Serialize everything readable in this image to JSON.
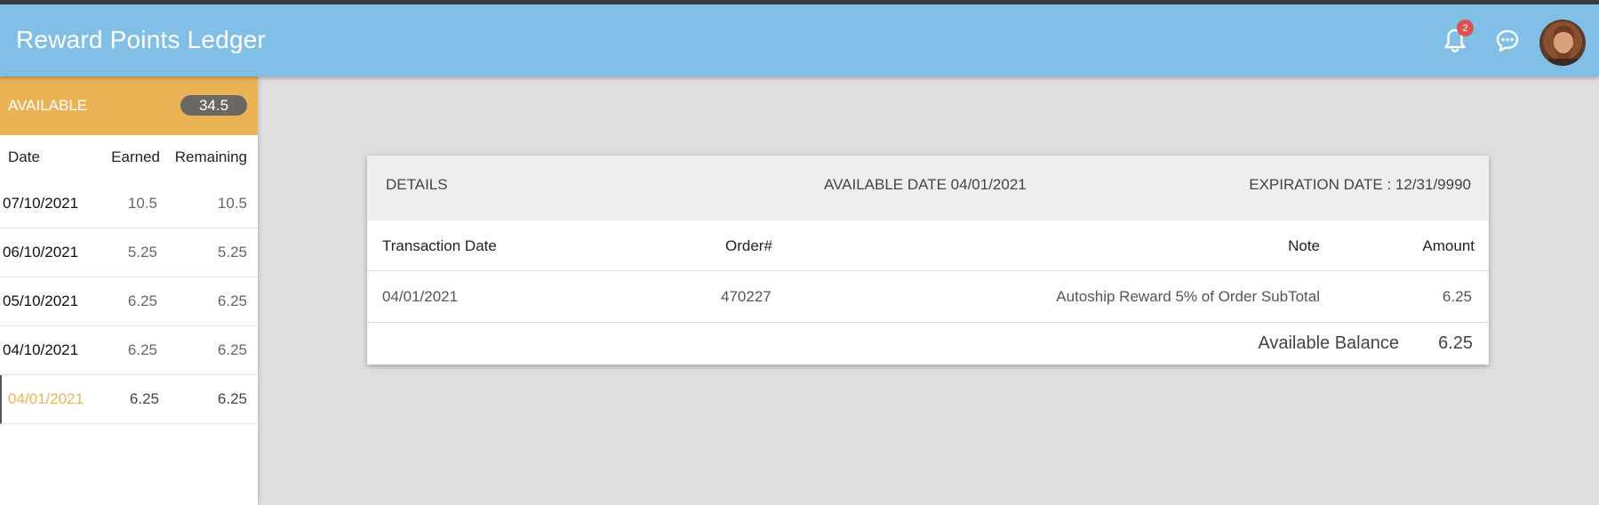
{
  "header": {
    "title": "Reward Points Ledger",
    "notification_count": "2",
    "icons": [
      "bell-icon",
      "chat-icon"
    ],
    "color": "#82bfe6"
  },
  "sidebar": {
    "available_label": "AVAILABLE",
    "available_value": "34.5",
    "columns": {
      "date": "Date",
      "earned": "Earned",
      "remaining": "Remaining"
    },
    "rows": [
      {
        "date": "07/10/2021",
        "earned": "10.5",
        "remaining": "10.5"
      },
      {
        "date": "06/10/2021",
        "earned": "5.25",
        "remaining": "5.25"
      },
      {
        "date": "05/10/2021",
        "earned": "6.25",
        "remaining": "6.25"
      },
      {
        "date": "04/10/2021",
        "earned": "6.25",
        "remaining": "6.25"
      },
      {
        "date": "04/01/2021",
        "earned": "6.25",
        "remaining": "6.25"
      }
    ],
    "accent": "#e9b356"
  },
  "details": {
    "title": "DETAILS",
    "available_date": "AVAILABLE DATE 04/01/2021",
    "expiration_date": "EXPIRATION DATE : 12/31/9990",
    "columns": {
      "transaction_date": "Transaction Date",
      "order": "Order#",
      "note": "Note",
      "amount": "Amount"
    },
    "rows": [
      {
        "transaction_date": "04/01/2021",
        "order": "470227",
        "note": "Autoship Reward 5% of Order SubTotal",
        "amount": "6.25"
      }
    ],
    "balance_label": "Available Balance",
    "balance_value": "6.25"
  }
}
